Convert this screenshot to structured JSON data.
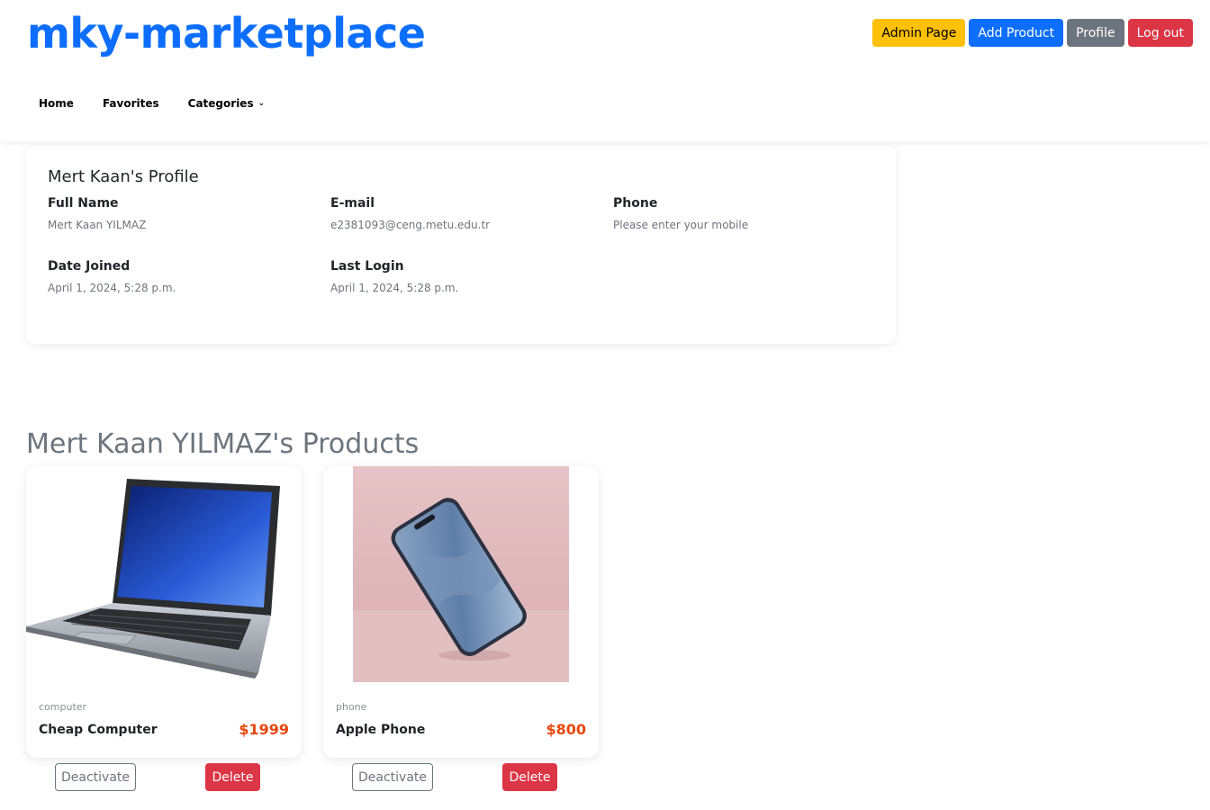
{
  "brand": "mky-marketplace",
  "header_buttons": {
    "admin": "Admin Page",
    "add_product": "Add Product",
    "profile": "Profile",
    "logout": "Log out"
  },
  "nav": {
    "home": "Home",
    "favorites": "Favorites",
    "categories": "Categories"
  },
  "profile": {
    "title": "Mert Kaan's Profile",
    "full_name_label": "Full Name",
    "full_name": "Mert Kaan YILMAZ",
    "email_label": "E-mail",
    "email": "e2381093@ceng.metu.edu.tr",
    "phone_label": "Phone",
    "phone": "Please enter your mobile",
    "date_joined_label": "Date Joined",
    "date_joined": "April 1, 2024, 5:28 p.m.",
    "last_login_label": "Last Login",
    "last_login": "April 1, 2024, 5:28 p.m."
  },
  "products_title": "Mert Kaan YILMAZ's Products",
  "products": [
    {
      "category": "computer",
      "name": "Cheap Computer",
      "price": "$1999",
      "deactivate": "Deactivate",
      "delete": "Delete"
    },
    {
      "category": "phone",
      "name": "Apple Phone",
      "price": "$800",
      "deactivate": "Deactivate",
      "delete": "Delete"
    }
  ],
  "colors": {
    "brand": "#0d6efd",
    "warning": "#ffc107",
    "secondary": "#6c757d",
    "danger": "#dc3545",
    "price": "#e8470d"
  }
}
